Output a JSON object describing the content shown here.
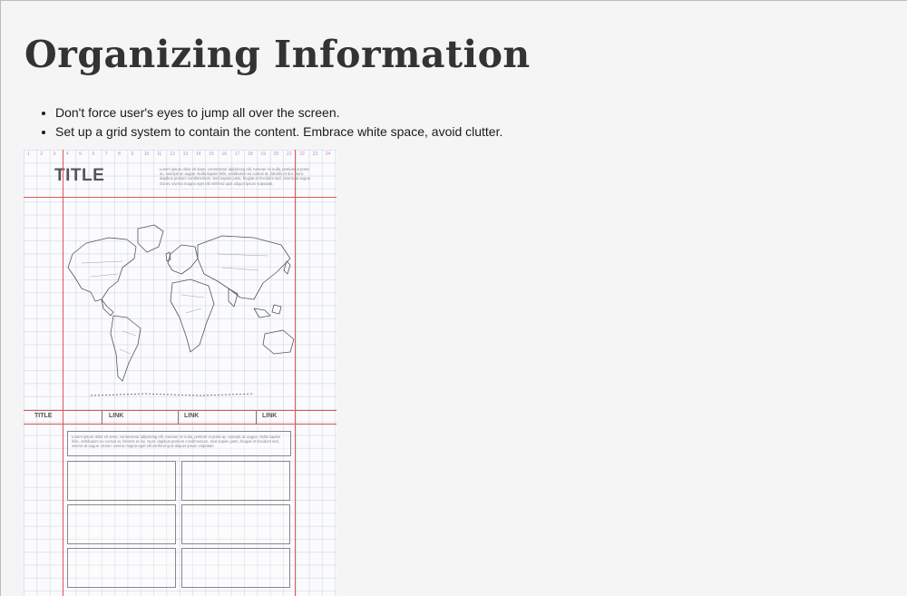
{
  "slide": {
    "title": "Organizing Information",
    "bullets": [
      "Don't force user's eyes to jump all over the screen.",
      "Set up a grid system to contain the content. Embrace white space, avoid clutter."
    ]
  },
  "figure": {
    "column_numbers": [
      "1",
      "2",
      "3",
      "4",
      "5",
      "6",
      "7",
      "8",
      "9",
      "10",
      "11",
      "12",
      "13",
      "14",
      "15",
      "16",
      "17",
      "18",
      "19",
      "20",
      "21",
      "22",
      "23",
      "24"
    ],
    "title": "TITLE",
    "intro_text": "Lorem ipsum dolor sit amet, consectetur adipiscing elit. Aenean mi nulla, pretium ut porta ac, suscipit ac augue. Nulla sapien felis, vestibulum eu cursus at, lobortis et dui. Nunc dapibus pretium condimentum. Sed sapien justo, feugiat et tincidunt sed, viverra at augue. Donec viverra magna eget elit eleifend quis aliquet ipsum vulputate.",
    "nav": {
      "title": "TITLE",
      "links": [
        "LINK",
        "LINK",
        "LINK"
      ]
    },
    "body_text": "Lorem ipsum dolor sit amet, consectetur adipiscing elit. Aenean mi nulla, pretium ut porta ac, suscipit ac augue. Nulla sapien felis, vestibulum eu cursus at, lobortis et dui. Nunc dapibus pretium condimentum. Sed sapien justo, feugiat et tincidunt sed, viverra at augue. Donec viverra magna eget elit eleifend quis aliquet ipsum vulputate.",
    "colors": {
      "guide_line": "#e0565a",
      "column_numbers": "#c987c9",
      "grid": "#aab9d7"
    }
  }
}
